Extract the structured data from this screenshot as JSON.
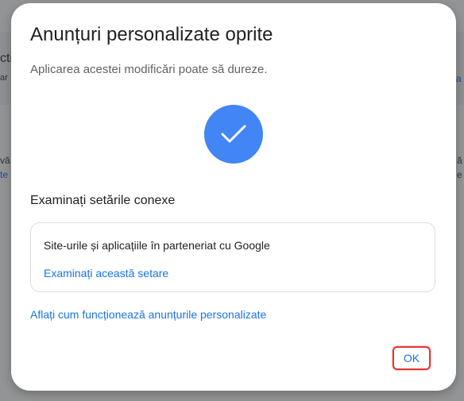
{
  "background": {
    "fragments": [
      "cti",
      "ar",
      "a",
      "vă",
      "te",
      "ă",
      "e"
    ]
  },
  "dialog": {
    "title": "Anunțuri personalizate oprite",
    "subtitle": "Aplicarea acestei modificări poate să dureze.",
    "status_icon": "check-icon",
    "related_heading": "Examinați setările conexe",
    "card": {
      "text": "Site-urile și aplicațiile în parteneriat cu Google",
      "link": "Examinați această setare"
    },
    "learn_link": "Aflați cum funcționează anunțurile personalizate",
    "ok_label": "OK"
  },
  "colors": {
    "accent": "#1a73e8",
    "check_circle": "#4285f4",
    "highlight": "#e53935"
  }
}
